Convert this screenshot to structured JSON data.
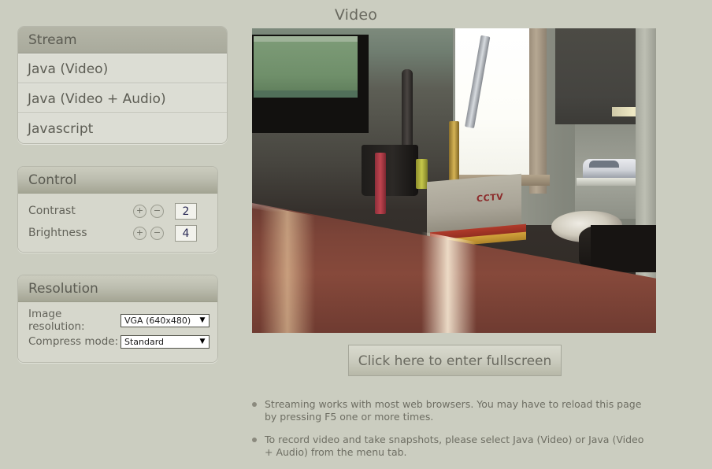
{
  "page": {
    "title": "Video",
    "background_color": "#cbcdc0"
  },
  "stream": {
    "header": "Stream",
    "items": [
      {
        "label": "Java (Video)"
      },
      {
        "label": "Java (Video + Audio)"
      },
      {
        "label": "Javascript"
      }
    ]
  },
  "control": {
    "header": "Control",
    "increase_symbol": "+",
    "decrease_symbol": "−",
    "rows": [
      {
        "label": "Contrast",
        "value": "2"
      },
      {
        "label": "Brightness",
        "value": "4"
      }
    ]
  },
  "resolution": {
    "header": "Resolution",
    "arrow_glyph": "▼",
    "rows": [
      {
        "label": "Image resolution:",
        "value": "VGA (640x480)",
        "options": [
          "VGA (640x480)"
        ]
      },
      {
        "label": "Compress mode:",
        "value": "Standard",
        "options": [
          "Standard"
        ]
      }
    ]
  },
  "video": {
    "alt": "live-camera-stream",
    "scene_text": {
      "box_label": "CCTV"
    }
  },
  "fullscreen": {
    "label": "Click here to enter fullscreen"
  },
  "notes": [
    {
      "text": "Streaming works with most web browsers. You may have to reload this page by pressing F5 one or more times."
    },
    {
      "text": "To record video and take snapshots, please select Java (Video) or Java (Video + Audio) from the menu tab."
    }
  ]
}
